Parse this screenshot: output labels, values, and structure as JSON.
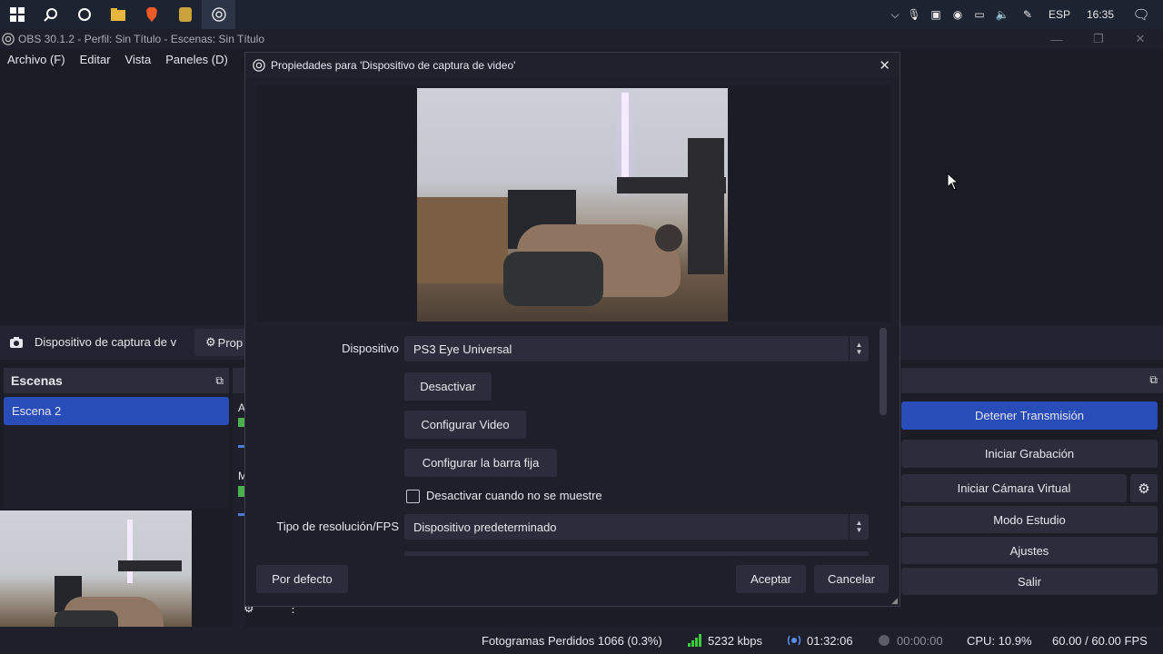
{
  "taskbar": {
    "icons": [
      "windows-start-icon",
      "search-icon",
      "cortana-icon",
      "file-explorer-icon",
      "brave-browser-icon",
      "app-icon",
      "obs-icon"
    ],
    "language": "ESP",
    "time": "16:35"
  },
  "window": {
    "title": "OBS 30.1.2 - Perfil: Sin Título - Escenas: Sin Título"
  },
  "menu": {
    "items": [
      "Archivo (F)",
      "Editar",
      "Vista",
      "Paneles (D)"
    ]
  },
  "source_toolbar": {
    "source_name": "Dispositivo de captura de v",
    "properties_label": "Prop"
  },
  "scenes": {
    "title": "Escenas",
    "items": [
      "Escena 2"
    ]
  },
  "mixer_fragments": {
    "a": "A",
    "m": "M"
  },
  "controls": {
    "stop_stream": "Detener Transmisión",
    "start_recording": "Iniciar Grabación",
    "start_virtual_cam": "Iniciar Cámara Virtual",
    "studio_mode": "Modo Estudio",
    "settings": "Ajustes",
    "exit": "Salir"
  },
  "status": {
    "dropped_frames": "Fotogramas Perdidos 1066 (0.3%)",
    "bitrate": "5232 kbps",
    "stream_time": "01:32:06",
    "record_time": "00:00:00",
    "cpu": "CPU: 10.9%",
    "fps": "60.00 / 60.00 FPS"
  },
  "dialog": {
    "title": "Propiedades para 'Dispositivo de captura de video'",
    "device_label": "Dispositivo",
    "device_value": "PS3 Eye Universal",
    "deactivate": "Desactivar",
    "configure_video": "Configurar Video",
    "configure_crossbar": "Configurar la barra fija",
    "deactivate_when_hidden": "Desactivar cuando no se muestre",
    "deactivate_when_hidden_checked": false,
    "resolution_label": "Tipo de resolución/FPS",
    "resolution_value": "Dispositivo predeterminado",
    "defaults": "Por defecto",
    "accept": "Aceptar",
    "cancel": "Cancelar"
  },
  "colors": {
    "accent": "#284cb8",
    "background": "#1b1c26",
    "panel": "#2b2d3c",
    "bitrate_icon": "#3cc93c"
  }
}
